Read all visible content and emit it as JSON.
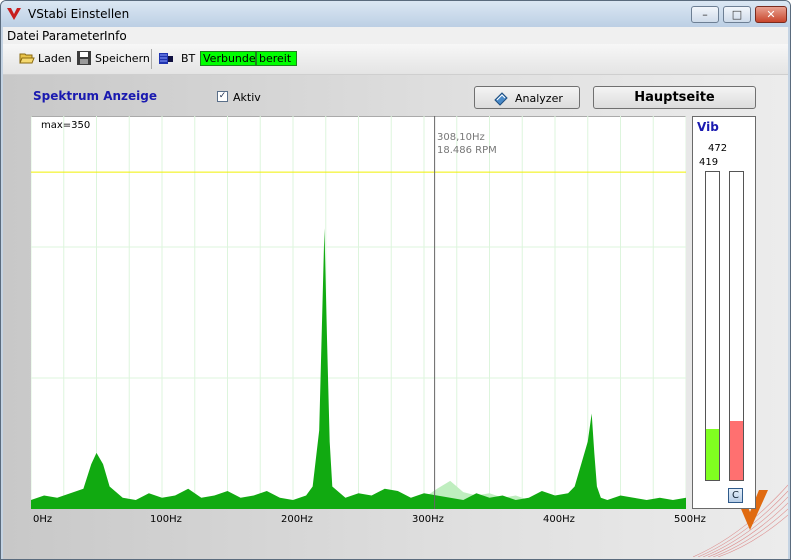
{
  "window": {
    "title": "VStabi Einstellen",
    "min_label": "–",
    "max_label": "□",
    "close_label": "✕"
  },
  "menu": [
    "Datei",
    "Parameter",
    "Info"
  ],
  "toolbar": {
    "load": "Laden",
    "save": "Speichern",
    "bt": "BT",
    "status1": "Verbunden",
    "status2": "bereit"
  },
  "panel": {
    "heading": "Spektrum Anzeige",
    "aktiv_label": "Aktiv",
    "aktiv_checked": true,
    "analyzer_label": "Analyzer",
    "mainpage_label": "Hauptseite"
  },
  "vib": {
    "title": "Vib",
    "value_top": "472",
    "value_left": "419",
    "reset_label": "C",
    "bar1_level": 0.165,
    "bar1_color": "#80ff20",
    "bar2_level": 0.19,
    "bar2_color": "#ff7070"
  },
  "colors": {
    "accent_blue": "#1a1ab0",
    "status_green": "#00ff00",
    "spectrum_fill": "#11aa11",
    "spectrum_light": "#bfeebf",
    "reference_line": "#f0f000"
  },
  "chart_data": {
    "type": "area",
    "max_label": "max=350",
    "cursor_label1": "308,10Hz",
    "cursor_label2": "18.486 RPM",
    "cursor_x": 308.1,
    "reference_y": 300,
    "xlim": [
      0,
      500
    ],
    "ylim": [
      0,
      350
    ],
    "x_ticks": [
      "0Hz",
      "100Hz",
      "200Hz",
      "300Hz",
      "400Hz",
      "500Hz"
    ],
    "grid": true,
    "series": [
      {
        "x": [
          0,
          10,
          20,
          30,
          40,
          46,
          50,
          55,
          60,
          70,
          80,
          90,
          100,
          110,
          120,
          130,
          140,
          150,
          160,
          170,
          180,
          190,
          200,
          210,
          215,
          220,
          222,
          224,
          226,
          228,
          230,
          240,
          250,
          260,
          270,
          280,
          290,
          300,
          310,
          320,
          330,
          340,
          350,
          360,
          370,
          380,
          390,
          400,
          410,
          415,
          420,
          425,
          428,
          430,
          432,
          435,
          440,
          450,
          460,
          470,
          480,
          490,
          500
        ],
        "y": [
          8,
          12,
          10,
          14,
          18,
          40,
          50,
          40,
          20,
          10,
          8,
          14,
          10,
          12,
          18,
          10,
          12,
          16,
          10,
          12,
          16,
          10,
          8,
          12,
          20,
          70,
          160,
          250,
          150,
          60,
          20,
          10,
          14,
          12,
          18,
          16,
          10,
          14,
          12,
          10,
          8,
          14,
          10,
          12,
          8,
          10,
          16,
          12,
          14,
          20,
          40,
          60,
          85,
          50,
          20,
          10,
          8,
          12,
          10,
          8,
          10,
          8,
          10
        ]
      },
      {
        "x": [
          290,
          300,
          310,
          320,
          330,
          340,
          350,
          360,
          370,
          380,
          390,
          400,
          410
        ],
        "y": [
          0,
          10,
          18,
          25,
          15,
          12,
          14,
          10,
          12,
          8,
          10,
          6,
          0
        ]
      }
    ]
  }
}
